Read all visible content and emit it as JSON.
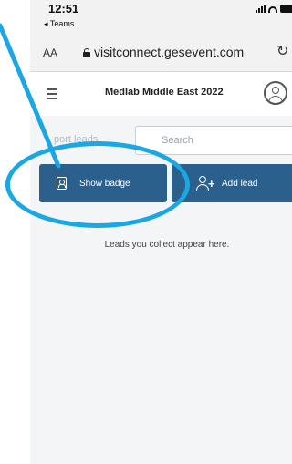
{
  "status_bar": {
    "time": "12:51",
    "back_app": "◂ Teams",
    "icons": [
      "cellular-signal-icon",
      "wifi-icon",
      "battery-icon"
    ]
  },
  "browser": {
    "text_size_label": "AA",
    "url": "visitconnect.gesevent.com"
  },
  "app": {
    "title": "Medlab Middle East 2022"
  },
  "toolbar": {
    "export_label": "port leads",
    "search_placeholder": "Search"
  },
  "actions": {
    "show_badge_label": "Show badge",
    "add_lead_label": "Add lead"
  },
  "content": {
    "empty_message": "Leads you collect appear here."
  },
  "colors": {
    "primary_button": "#2b5f8c",
    "annotation": "#1aa7e3",
    "background": "#f4f5f7"
  }
}
